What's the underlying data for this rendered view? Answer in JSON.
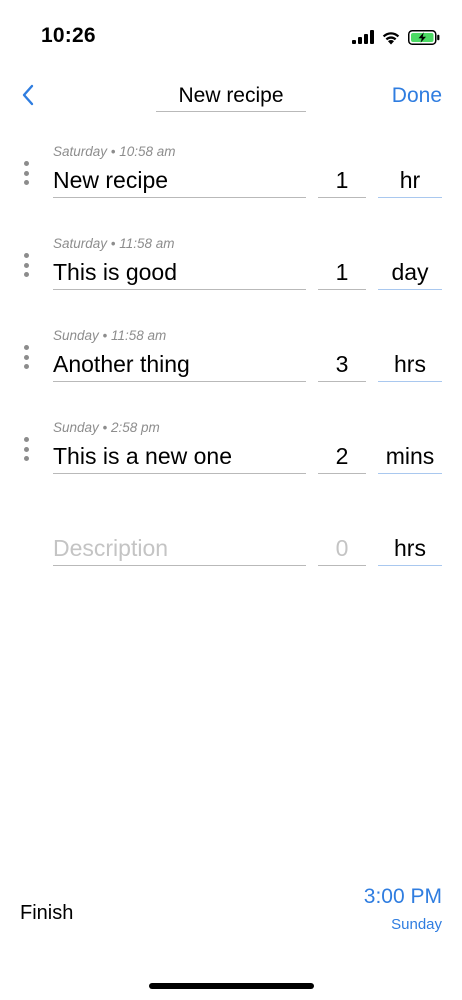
{
  "status_bar": {
    "time": "10:26",
    "icons": [
      "cellular-signal-icon",
      "wifi-icon",
      "battery-charging-icon"
    ],
    "battery_color": "#4cd964"
  },
  "nav": {
    "back_icon": "chevron-left-icon",
    "title_value": "New recipe",
    "done_label": "Done"
  },
  "steps": [
    {
      "time": "Saturday • 10:58 am",
      "description": "New recipe",
      "quantity": "1",
      "unit": "hr"
    },
    {
      "time": "Saturday • 11:58 am",
      "description": "This is good",
      "quantity": "1",
      "unit": "day"
    },
    {
      "time": "Sunday • 11:58 am",
      "description": "Another thing",
      "quantity": "3",
      "unit": "hrs"
    },
    {
      "time": "Sunday • 2:58 pm",
      "description": "This is a new one",
      "quantity": "2",
      "unit": "mins"
    }
  ],
  "new_step": {
    "description_placeholder": "Description",
    "quantity_placeholder": "0",
    "unit": "hrs"
  },
  "finish": {
    "label": "Finish",
    "time": "3:00 PM",
    "day": "Sunday"
  },
  "colors": {
    "accent": "#2f7de0",
    "divider": "#b9b9b9",
    "secondary_text": "#8d8d8d",
    "placeholder": "#c4c4c4"
  }
}
